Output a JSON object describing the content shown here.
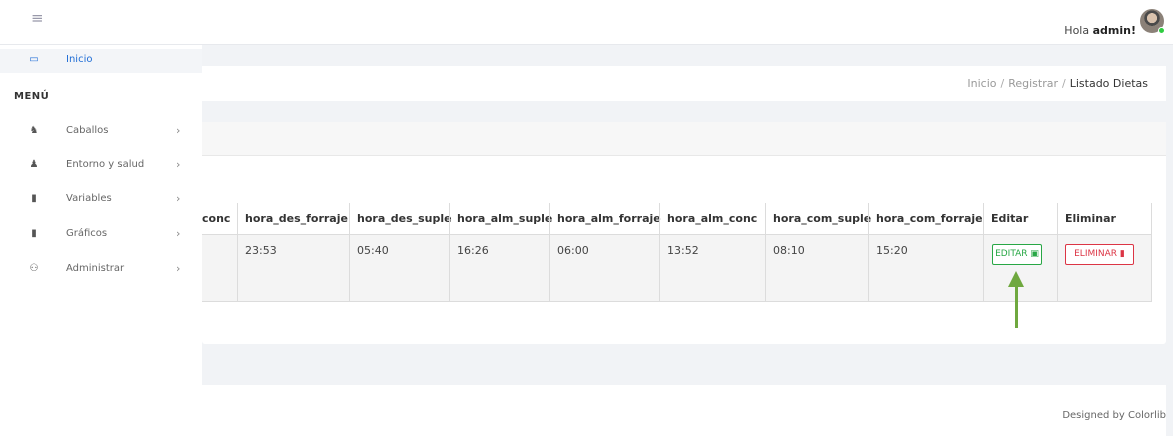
{
  "topbar": {
    "greeting_prefix": "Hola",
    "user": "admin!",
    "menu_icon": "hamburger-icon"
  },
  "sidebar": {
    "home": {
      "label": "Inicio",
      "icon": "laptop-icon"
    },
    "menu_title": "MENÚ",
    "items": [
      {
        "label": "Caballos",
        "icon": "horse-icon"
      },
      {
        "label": "Entorno y salud",
        "icon": "user-icon"
      },
      {
        "label": "Variables",
        "icon": "file-icon"
      },
      {
        "label": "Gráficos",
        "icon": "file-icon"
      },
      {
        "label": "Administrar",
        "icon": "users-icon"
      }
    ]
  },
  "breadcrumb": {
    "item1": "Inicio",
    "item2": "Registrar",
    "current": "Listado Dietas",
    "sep": "/"
  },
  "table": {
    "headers": [
      "conc",
      "hora_des_forraje",
      "hora_des_suple",
      "hora_alm_suple",
      "hora_alm_forraje",
      "hora_alm_conc",
      "hora_com_suple",
      "hora_com_forraje",
      "Editar",
      "Eliminar"
    ],
    "row": [
      "",
      "23:53",
      "05:40",
      "16:26",
      "06:00",
      "13:52",
      "08:10",
      "15:20"
    ]
  },
  "buttons": {
    "edit": "EDITAR",
    "delete": "ELIMINAR"
  },
  "colors": {
    "accent": "#1f6dd6",
    "edit": "#28a745",
    "delete": "#dc3545",
    "arrow": "#6fa83f"
  },
  "footer": {
    "text": "Designed by Colorlib"
  }
}
